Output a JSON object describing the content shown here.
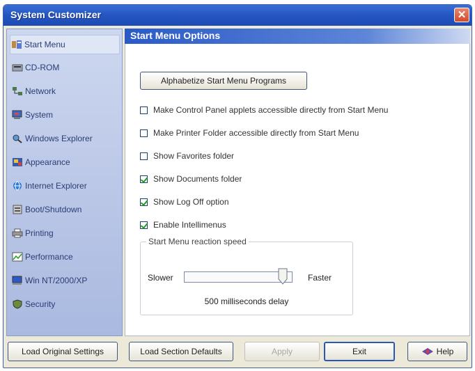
{
  "window": {
    "title": "System Customizer",
    "close_symbol": "✕"
  },
  "sidebar": {
    "items": [
      {
        "label": "Start Menu",
        "icon": "start-menu-icon",
        "active": true
      },
      {
        "label": "CD-ROM",
        "icon": "cd-rom-icon"
      },
      {
        "label": "Network",
        "icon": "network-icon"
      },
      {
        "label": "System",
        "icon": "system-icon"
      },
      {
        "label": "Windows Explorer",
        "icon": "windows-explorer-icon"
      },
      {
        "label": "Appearance",
        "icon": "appearance-icon"
      },
      {
        "label": "Internet Explorer",
        "icon": "internet-explorer-icon"
      },
      {
        "label": "Boot/Shutdown",
        "icon": "boot-shutdown-icon"
      },
      {
        "label": "Printing",
        "icon": "printer-icon"
      },
      {
        "label": "Performance",
        "icon": "performance-icon"
      },
      {
        "label": "Win NT/2000/XP",
        "icon": "win-nt-icon"
      },
      {
        "label": "Security",
        "icon": "security-icon"
      }
    ]
  },
  "main": {
    "header": "Start Menu Options",
    "alphabetize_button": "Alphabetize Start Menu Programs",
    "options": [
      {
        "label": "Make Control Panel applets accessible directly from Start Menu",
        "checked": false
      },
      {
        "label": "Make Printer Folder accessible directly from Start Menu",
        "checked": false
      },
      {
        "label": "Show Favorites folder",
        "checked": false
      },
      {
        "label": "Show Documents folder",
        "checked": true
      },
      {
        "label": "Show Log Off option",
        "checked": true
      },
      {
        "label": "Enable Intellimenus",
        "checked": true
      }
    ],
    "speed": {
      "legend": "Start Menu reaction speed",
      "slower": "Slower",
      "faster": "Faster",
      "delay_text": "500 milliseconds delay",
      "slider_position": 0.95
    }
  },
  "bottom_buttons": {
    "load_original": "Load Original Settings",
    "load_section": "Load Section Defaults",
    "apply": "Apply",
    "exit": "Exit",
    "help": "Help"
  },
  "colors": {
    "titlebar": "#2757c4",
    "header": "#2a5ac6",
    "checkmark": "#1f9b1f",
    "close": "#d4492a"
  }
}
